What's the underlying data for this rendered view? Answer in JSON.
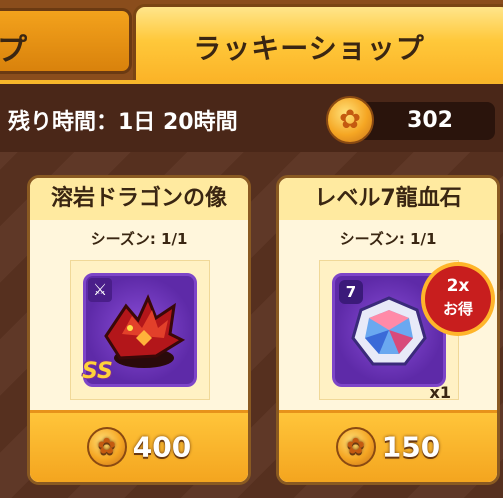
{
  "tabs": {
    "left_label": "プ",
    "active_label": "ラッキーショップ"
  },
  "infobar": {
    "timer_text": "残り時間：1日 20時間",
    "coin_count": "302"
  },
  "cards": [
    {
      "title": "溶岩ドラゴンの像",
      "season": "シーズン: 1/1",
      "rarity": "SS",
      "price": "400",
      "icon": "lava-dragon-statue"
    },
    {
      "title": "レベル7龍血石",
      "season": "シーズン: 1/1",
      "level_badge": "7",
      "quantity": "x1",
      "bonus_line1": "2x",
      "bonus_line2": "お得",
      "price": "150",
      "icon": "dragon-blood-gem"
    }
  ],
  "colors": {
    "accent": "#f7b62a",
    "bg": "#5a3220",
    "card": "#fff6dc",
    "bonus": "#c81e1e"
  }
}
